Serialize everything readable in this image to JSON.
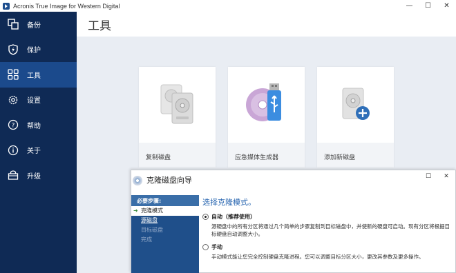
{
  "window": {
    "title": "Acronis True Image for Western Digital",
    "minimize": "—",
    "maximize": "☐",
    "close": "✕"
  },
  "sidebar": {
    "items": [
      {
        "label": "备份",
        "icon": "backup-icon"
      },
      {
        "label": "保护",
        "icon": "shield-icon"
      },
      {
        "label": "工具",
        "icon": "tools-grid-icon",
        "active": true
      },
      {
        "label": "设置",
        "icon": "gear-icon"
      },
      {
        "label": "帮助",
        "icon": "help-icon"
      },
      {
        "label": "关于",
        "icon": "info-icon"
      },
      {
        "label": "升级",
        "icon": "cart-icon"
      }
    ]
  },
  "main": {
    "title": "工具",
    "cards": [
      {
        "label": "复制磁盘",
        "icon": "clone-disk-icon"
      },
      {
        "label": "应急媒体生成器",
        "icon": "rescue-media-icon"
      },
      {
        "label": "添加新磁盘",
        "icon": "add-disk-icon"
      }
    ]
  },
  "dialog": {
    "title": "克隆磁盘向导",
    "minimize": "☐",
    "close": "✕",
    "steps_header": "必要步骤:",
    "steps": [
      {
        "label": "克隆模式",
        "state": "current"
      },
      {
        "label": "源磁盘",
        "state": "next"
      },
      {
        "label": "目标磁盘",
        "state": "pending"
      },
      {
        "label": "完成",
        "state": "pending"
      }
    ],
    "heading": "选择克隆模式。",
    "options": [
      {
        "label": "自动（推荐使用）",
        "checked": true,
        "description": "源硬盘中的所有分区将通过几个简单的步骤复制到目标磁盘中，并使新的硬盘可启动。现有分区将根据目标硬盘自动调整大小。"
      },
      {
        "label": "手动",
        "checked": false,
        "description": "手动模式能让您完全控制硬盘克隆进程。您可以调整目标分区大小，更改其参数及更多操作。"
      }
    ]
  },
  "colors": {
    "sidebar_bg": "#0f2a55",
    "sidebar_active": "#1b4a8c",
    "accent_blue": "#2a67b1"
  }
}
